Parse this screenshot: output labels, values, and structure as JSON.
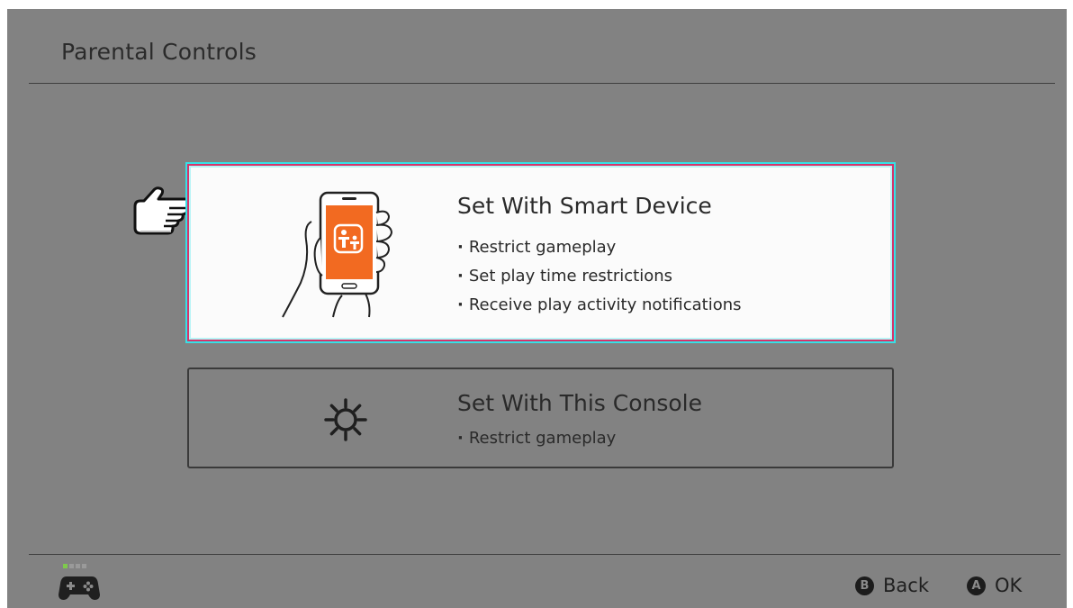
{
  "header": {
    "title": "Parental Controls"
  },
  "options": [
    {
      "title": "Set With Smart Device",
      "selected": true,
      "features": [
        "Restrict gameplay",
        "Set play time restrictions",
        "Receive play activity notifications"
      ],
      "icon": "smartphone-parental-app-icon"
    },
    {
      "title": "Set With This Console",
      "selected": false,
      "features": [
        "Restrict gameplay"
      ],
      "icon": "gear-icon"
    }
  ],
  "footer": {
    "back_button": "B",
    "back_label": "Back",
    "ok_button": "A",
    "ok_label": "OK",
    "controller_icon": "controller-icon"
  },
  "colors": {
    "background": "#828282",
    "selected_card": "#fbfbfb",
    "selection_border": "#d6346a",
    "selection_glow": "#36e0e6",
    "app_orange": "#f26a21",
    "controller_indicator": "#7ec94c"
  }
}
